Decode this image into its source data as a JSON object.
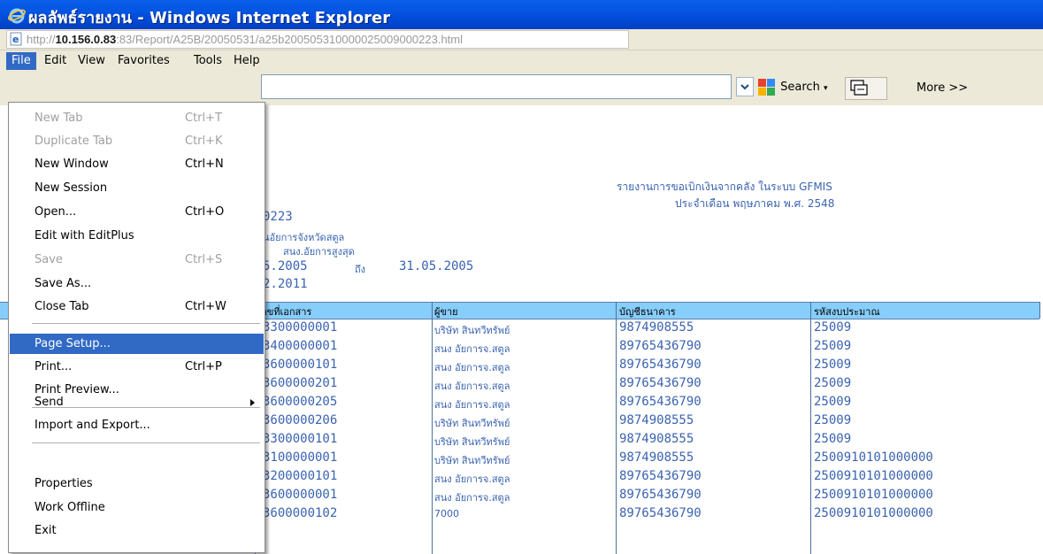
{
  "window": {
    "title": "ผลลัพธ์รายงาน - Windows Internet Explorer",
    "title_color": "#ffffff",
    "titlebar_color": "#0054e3"
  },
  "address": {
    "url_prefix": "http://",
    "url_host": "10.156.0.83",
    "url_rest": ":83/Report/A25B/20050531/a25b200505310000025009000223.html"
  },
  "menubar": {
    "items": [
      "File",
      "Edit",
      "View",
      "Favorites",
      "Tools",
      "Help"
    ],
    "active": "File"
  },
  "toolbar": {
    "search_label": "Search",
    "more_label": "More >>"
  },
  "report": {
    "title_thai": "รายงานการขอเบิกเงินจากคลัง ในระบบ GFMIS",
    "period_thai": "ประจำเดือน พฤษภาคม พ.ศ. 2548",
    "doc_number_fragment": "0223",
    "org_fragment": "นอัยการจังหวัดสตูล",
    "sub_org_fragment": "สนง.อัยการสูงสุด",
    "from_date_fragment": "5.2005",
    "to_word": "ถึง",
    "to_date": "31.05.2005",
    "print_date_fragment": "2.2011",
    "columns": [
      "ลขที่เอกสาร",
      "ผู้ขาย",
      "บัญชีธนาคาร",
      "รหัสงบประมาณ"
    ],
    "rows": [
      {
        "doc": "3300000001",
        "vendor": "บริษัท สินทวีทรัพย์",
        "account": "9874908555",
        "budget": "25009"
      },
      {
        "doc": "3400000001",
        "vendor": "สนง อัยการจ.สตูล",
        "account": "89765436790",
        "budget": "25009"
      },
      {
        "doc": "3600000101",
        "vendor": "สนง อัยการจ.สตูล",
        "account": "89765436790",
        "budget": "25009"
      },
      {
        "doc": "3600000201",
        "vendor": "สนง อัยการจ.สตูล",
        "account": "89765436790",
        "budget": "25009"
      },
      {
        "doc": "3600000205",
        "vendor": "สนง อัยการจ.สตูล",
        "account": "89765436790",
        "budget": "25009"
      },
      {
        "doc": "3600000206",
        "vendor": "บริษัท สินทวีทรัพย์",
        "account": "9874908555",
        "budget": "25009"
      },
      {
        "doc": "3300000101",
        "vendor": "บริษัท สินทวีทรัพย์",
        "account": "9874908555",
        "budget": "25009"
      },
      {
        "doc": "3100000001",
        "vendor": "บริษัท สินทวีทรัพย์",
        "account": "9874908555",
        "budget": "2500910101000000"
      },
      {
        "doc": "3200000101",
        "vendor": "สนง อัยการจ.สตูล",
        "account": "89765436790",
        "budget": "2500910101000000"
      },
      {
        "doc": "3600000001",
        "vendor": "สนง อัยการจ.สตูล",
        "account": "89765436790",
        "budget": "2500910101000000"
      },
      {
        "doc": "3600000102",
        "vendor": "7000",
        "account": "89765436790",
        "budget": "2500910101000000"
      }
    ]
  },
  "file_menu": {
    "items": [
      {
        "label": "New Tab",
        "shortcut": "Ctrl+T",
        "disabled": true
      },
      {
        "label": "Duplicate Tab",
        "shortcut": "Ctrl+K",
        "disabled": true
      },
      {
        "label": "New Window",
        "shortcut": "Ctrl+N"
      },
      {
        "label": "New Session",
        "shortcut": ""
      },
      {
        "label": "Open...",
        "shortcut": "Ctrl+O"
      },
      {
        "label": "Edit with EditPlus",
        "shortcut": ""
      },
      {
        "label": "Save",
        "shortcut": "Ctrl+S",
        "disabled": true
      },
      {
        "label": "Save As...",
        "shortcut": ""
      },
      {
        "label": "Close Tab",
        "shortcut": "Ctrl+W"
      },
      {
        "label": "Page Setup...",
        "shortcut": "",
        "highlighted": true
      },
      {
        "label": "Print...",
        "shortcut": "Ctrl+P"
      },
      {
        "label": "Print Preview...",
        "shortcut": ""
      },
      {
        "label": "Send",
        "shortcut": "",
        "submenu": true
      },
      {
        "label": "Import and Export...",
        "shortcut": ""
      },
      {
        "label": "Properties",
        "shortcut": ""
      },
      {
        "label": "Work Offline",
        "shortcut": ""
      },
      {
        "label": "Exit",
        "shortcut": ""
      }
    ]
  },
  "colors": {
    "report_text": "#3a63b0",
    "table_header_bg": "#87cefa",
    "menu_highlight": "#316ac5"
  }
}
